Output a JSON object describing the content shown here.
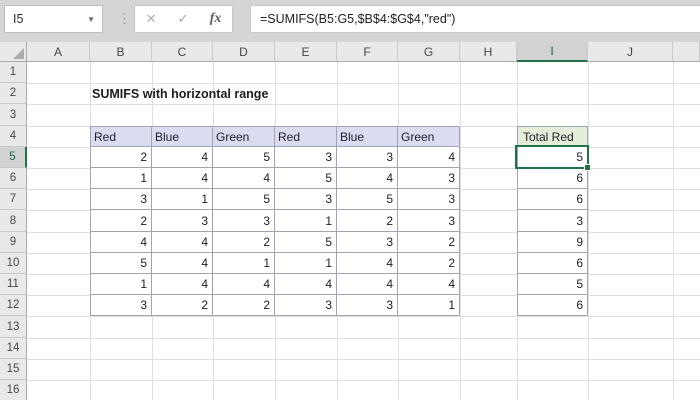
{
  "formula_bar": {
    "name_box_value": "I5",
    "cancel_label": "✕",
    "confirm_label": "✓",
    "fx_label": "fx",
    "formula": "=SUMIFS(B5:G5,$B$4:$G$4,\"red\")"
  },
  "icons": {
    "name_box_caret": "▼",
    "separator_dots": "⋮"
  },
  "sheet": {
    "title": "SUMIFS with horizontal range",
    "column_headers": [
      "A",
      "B",
      "C",
      "D",
      "E",
      "F",
      "G",
      "H",
      "I",
      "J"
    ],
    "row_headers": [
      "1",
      "2",
      "3",
      "4",
      "5",
      "6",
      "7",
      "8",
      "9",
      "10",
      "11",
      "12",
      "13",
      "14",
      "15",
      "16"
    ],
    "selected_column": "I",
    "selected_row": 5,
    "table": {
      "headers": [
        "Red",
        "Blue",
        "Green",
        "Red",
        "Blue",
        "Green"
      ],
      "rows": [
        [
          "2",
          "4",
          "5",
          "3",
          "3",
          "4"
        ],
        [
          "1",
          "4",
          "4",
          "5",
          "4",
          "3"
        ],
        [
          "3",
          "1",
          "5",
          "3",
          "5",
          "3"
        ],
        [
          "2",
          "3",
          "3",
          "1",
          "2",
          "3"
        ],
        [
          "4",
          "4",
          "2",
          "5",
          "3",
          "2"
        ],
        [
          "5",
          "4",
          "1",
          "1",
          "4",
          "2"
        ],
        [
          "1",
          "4",
          "4",
          "4",
          "4",
          "4"
        ],
        [
          "3",
          "2",
          "2",
          "3",
          "3",
          "1"
        ]
      ]
    },
    "totals": {
      "header": "Total Red",
      "values": [
        "5",
        "6",
        "6",
        "3",
        "9",
        "6",
        "5",
        "6"
      ]
    }
  },
  "colors": {
    "accent_green": "#217346",
    "table_header_fill": "#DBDCF2",
    "totals_header_fill": "#E3EFD9",
    "table_border": "#A3A3B3"
  }
}
